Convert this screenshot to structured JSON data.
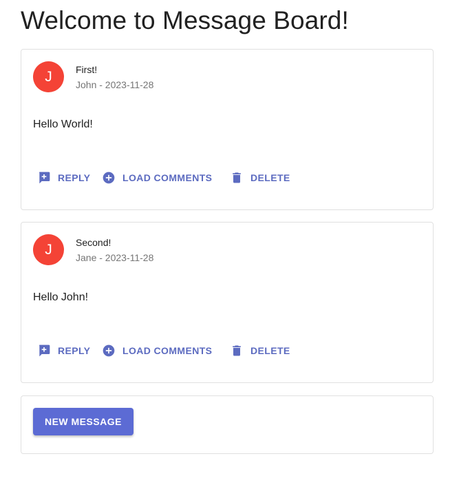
{
  "page": {
    "title": "Welcome to Message Board!"
  },
  "colors": {
    "avatar": "#f44336",
    "action": "#5c6bc0",
    "primary_button": "#5c6bd4",
    "card_border": "#e0e0e0"
  },
  "messages": [
    {
      "avatar_letter": "J",
      "title": "First!",
      "subheader": "John - 2023-11-28",
      "body": "Hello World!",
      "actions": {
        "reply": {
          "label": "REPLY",
          "icon": "add-comment-icon"
        },
        "load_comments": {
          "label": "LOAD COMMENTS",
          "icon": "add-circle-icon"
        },
        "delete": {
          "label": "DELETE",
          "icon": "trash-icon"
        }
      }
    },
    {
      "avatar_letter": "J",
      "title": "Second!",
      "subheader": "Jane - 2023-11-28",
      "body": "Hello John!",
      "actions": {
        "reply": {
          "label": "REPLY",
          "icon": "add-comment-icon"
        },
        "load_comments": {
          "label": "LOAD COMMENTS",
          "icon": "add-circle-icon"
        },
        "delete": {
          "label": "DELETE",
          "icon": "trash-icon"
        }
      }
    }
  ],
  "new_message": {
    "label": "NEW MESSAGE"
  }
}
